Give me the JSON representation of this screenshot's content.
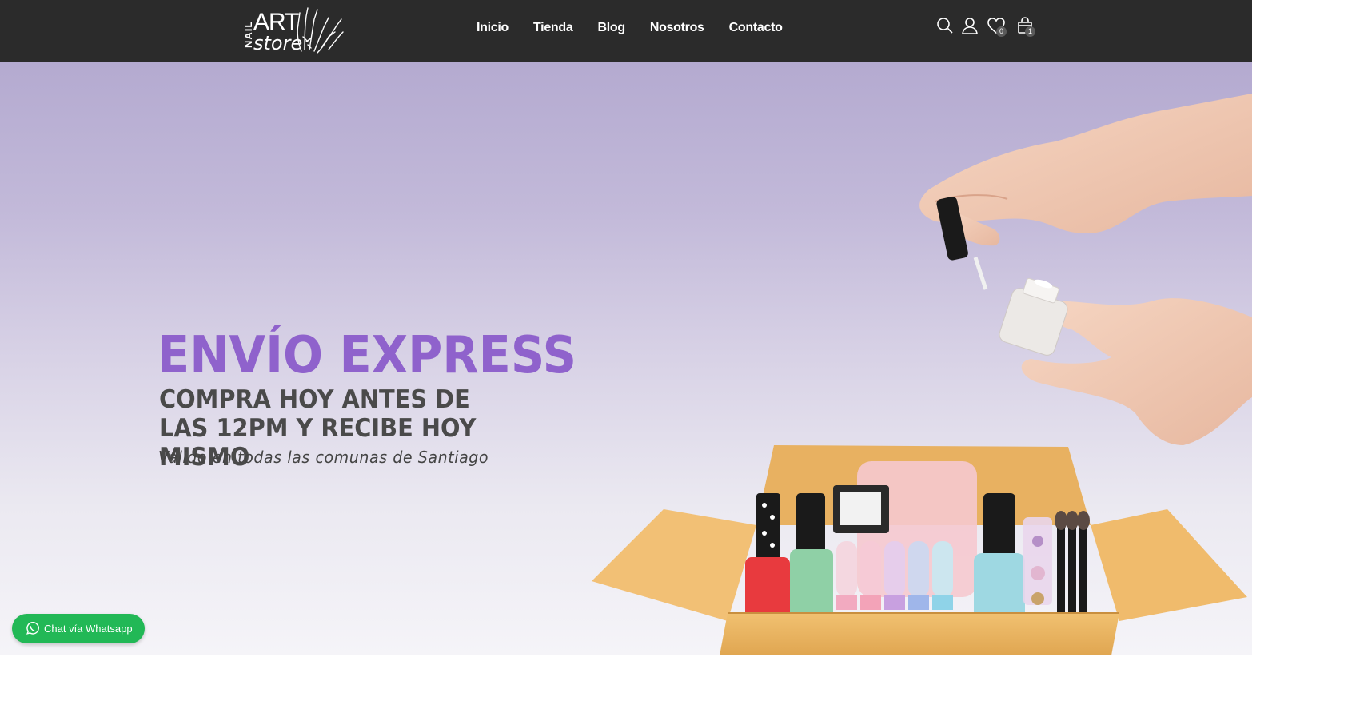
{
  "header": {
    "logo": {
      "word_vertical": "NAIL",
      "word_main": "ART",
      "word_sub": "store",
      "icon": "hands-illustration-icon"
    },
    "nav": [
      {
        "label": "Inicio"
      },
      {
        "label": "Tienda"
      },
      {
        "label": "Blog"
      },
      {
        "label": "Nosotros"
      },
      {
        "label": "Contacto"
      }
    ],
    "icons": {
      "search": "search-icon",
      "account": "user-icon",
      "wishlist": "heart-icon",
      "wishlist_count": "0",
      "cart": "shopping-bag-icon",
      "cart_count": "1"
    }
  },
  "hero": {
    "title": "ENVÍO EXPRESS",
    "subtitle": "COMPRA HOY ANTES DE LAS 12PM Y RECIBE HOY MISMO",
    "note": "Válido en todas las comunas de Santiago",
    "image": "hands-applying-nail-polish-over-open-box-of-nail-products",
    "accent_color": "#8f62cc"
  },
  "whatsapp": {
    "label": "Chat vía Whatsapp",
    "icon": "whatsapp-icon",
    "color": "#22b856"
  }
}
